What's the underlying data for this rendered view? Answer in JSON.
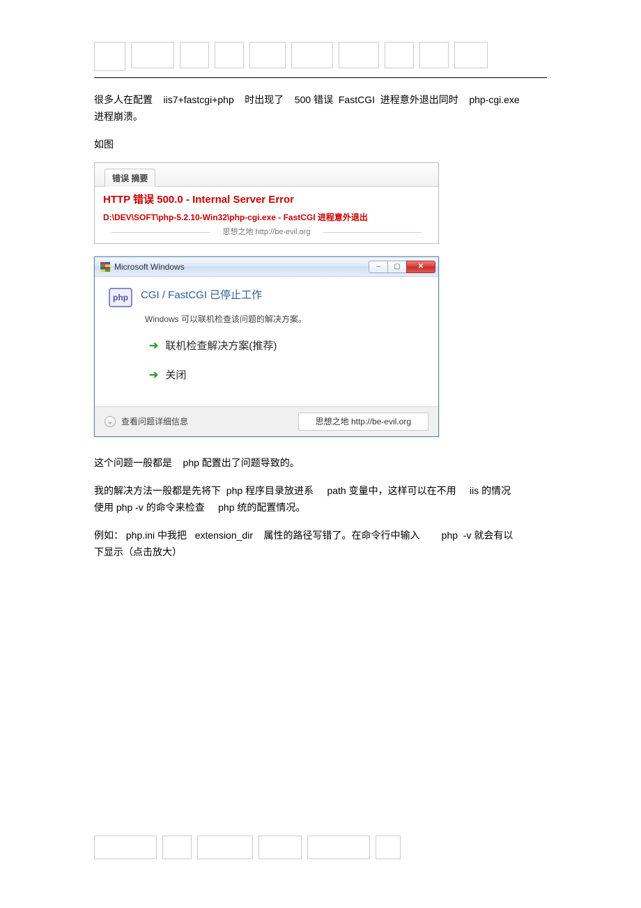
{
  "paragraphs": {
    "p1a": "很多人在配置    iis7+fastcgi+php    时出现了    500 错误  FastCGI  进程意外退出同时    php-cgi.exe",
    "p1b": "进程崩溃。",
    "p2": "如图",
    "p3": "这个问题一般都是    php 配置出了问题导致的。",
    "p4a": "我的解决方法一般都是先将下  php 程序目录放进系     path 变量中，这样可以在不用     iis 的情况",
    "p4b": "使用 php -v 的命令来检查     php 统的配置情况。",
    "p5a": "例如： php.ini 中我把   extension_dir    属性的路径写错了。在命令行中输入        php  -v 就会有以",
    "p5b": "下显示（点击放大）"
  },
  "error_block": {
    "tab": "错误 摘要",
    "title": "HTTP 错误 500.0 - Internal Server Error",
    "path": "D:\\DEV\\SOFT\\php-5.2.10-Win32\\php-cgi.exe - FastCGI 进程意外退出",
    "footer": "思想之地 http://be-evil.org"
  },
  "dialog": {
    "title": "Microsoft Windows",
    "badge": "php",
    "heading": "CGI / FastCGI 已停止工作",
    "sub": "Windows 可以联机检查该问题的解决方案。",
    "option1": "联机检查解决方案(推荐)",
    "option2": "关闭",
    "details": "查看问题详细信息",
    "brand": "思想之地 http://be-evil.org",
    "controls": {
      "min": "–",
      "max": "▢",
      "close": "✕"
    }
  }
}
